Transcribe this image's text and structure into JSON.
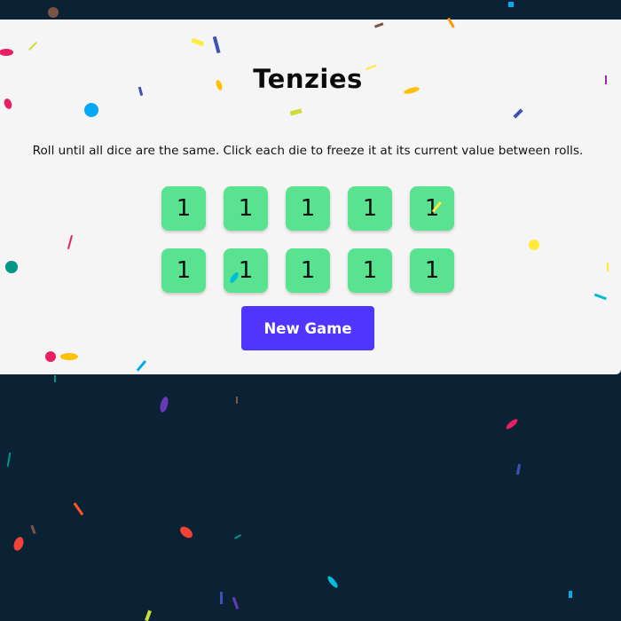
{
  "app": {
    "title": "Tenzies",
    "instructions": "Roll until all dice are the same. Click each die to freeze it at its current value between rolls."
  },
  "dice": [
    {
      "value": "1",
      "held": true
    },
    {
      "value": "1",
      "held": true
    },
    {
      "value": "1",
      "held": true
    },
    {
      "value": "1",
      "held": true
    },
    {
      "value": "1",
      "held": true
    },
    {
      "value": "1",
      "held": true
    },
    {
      "value": "1",
      "held": true
    },
    {
      "value": "1",
      "held": true
    },
    {
      "value": "1",
      "held": true
    },
    {
      "value": "1",
      "held": true
    }
  ],
  "button": {
    "label": "New Game"
  },
  "colors": {
    "page_background": "#0b2234",
    "card_background": "#f5f5f5",
    "held_die": "#59e391",
    "button": "#5035ff",
    "confetti": [
      "#f44336",
      "#e91e63",
      "#9c27b0",
      "#673ab7",
      "#3f51b5",
      "#2196f3",
      "#03a9f4",
      "#00bcd4",
      "#009688",
      "#4caf50",
      "#8bc34a",
      "#cddc39",
      "#ffeb3b",
      "#ffc107",
      "#ff9800",
      "#ff5722",
      "#795548"
    ]
  }
}
